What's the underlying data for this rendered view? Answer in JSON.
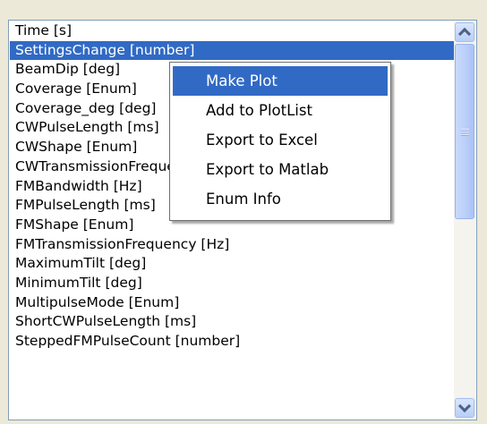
{
  "list": {
    "items": [
      "Time [s]",
      "SettingsChange [number]",
      "BeamDip [deg]",
      "Coverage [Enum]",
      "Coverage_deg [deg]",
      "CWPulseLength [ms]",
      "CWShape [Enum]",
      "CWTransmissionFrequency [Hz]",
      "FMBandwidth [Hz]",
      "FMPulseLength [ms]",
      "FMShape [Enum]",
      "FMTransmissionFrequency [Hz]",
      "MaximumTilt [deg]",
      "MinimumTilt [deg]",
      "MultipulseMode [Enum]",
      "ShortCWPulseLength [ms]",
      "SteppedFMPulseCount [number]"
    ],
    "selected_index": 1
  },
  "context_menu": {
    "items": [
      "Make Plot",
      "Add to PlotList",
      "Export to Excel",
      "Export to Matlab",
      "Enum Info"
    ],
    "highlighted_index": 0
  },
  "scrollbar": {
    "up_icon": "scroll-up-arrow-icon",
    "down_icon": "scroll-down-arrow-icon"
  },
  "colors": {
    "selection": "#316ac5",
    "selection_text": "#ffffff",
    "window_bg": "#ece9d8",
    "border": "#7f9db9"
  }
}
